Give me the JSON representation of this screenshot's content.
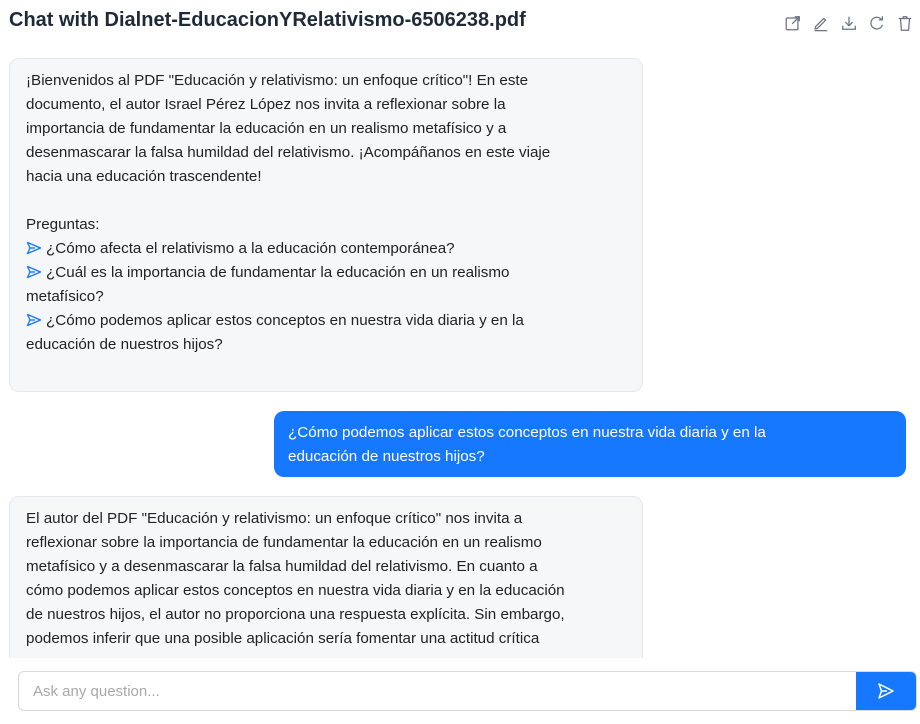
{
  "header": {
    "title": "Chat with Dialnet-EducacionYRelativismo-6506238.pdf",
    "tools": [
      "share-icon",
      "edit-icon",
      "download-icon",
      "refresh-icon",
      "delete-icon"
    ]
  },
  "messages": {
    "welcome": {
      "intro_lines": [
        "¡Bienvenidos al PDF \"Educación y relativismo: un enfoque crítico\"! En este",
        "documento, el autor Israel Pérez López nos invita a reflexionar sobre la",
        "importancia de fundamentar la educación en un realismo metafísico y a",
        "desenmascarar la falsa humildad del relativismo. ¡Acompáñanos en este viaje",
        "hacia una educación trascendente!"
      ],
      "questions_label": "Preguntas:",
      "questions": [
        {
          "lines": [
            "¿Cómo afecta el relativismo a la educación contemporánea?"
          ]
        },
        {
          "lines": [
            "¿Cuál es la importancia de fundamentar la educación en un realismo",
            "metafísico?"
          ]
        },
        {
          "lines": [
            "¿Cómo podemos aplicar estos conceptos en nuestra vida diaria y en la",
            "educación de nuestros hijos?"
          ]
        }
      ]
    },
    "user_question": {
      "lines": [
        "¿Cómo podemos aplicar estos conceptos en nuestra vida diaria y en la",
        "educación de nuestros hijos?"
      ]
    },
    "answer": {
      "lines": [
        "El autor del PDF \"Educación y relativismo: un enfoque crítico\" nos invita a",
        "reflexionar sobre la importancia de fundamentar la educación en un realismo",
        "metafísico y a desenmascarar la falsa humildad del relativismo. En cuanto a",
        "cómo podemos aplicar estos conceptos en nuestra vida diaria y en la educación",
        "de nuestros hijos, el autor no proporciona una respuesta explícita. Sin embargo,",
        "podemos inferir que una posible aplicación sería fomentar una actitud crítica"
      ]
    }
  },
  "input": {
    "placeholder": "Ask any question...",
    "value": ""
  },
  "colors": {
    "accent": "#1677ff",
    "bot_bubble": "#f6f7f9",
    "icon": "#6b7280"
  }
}
